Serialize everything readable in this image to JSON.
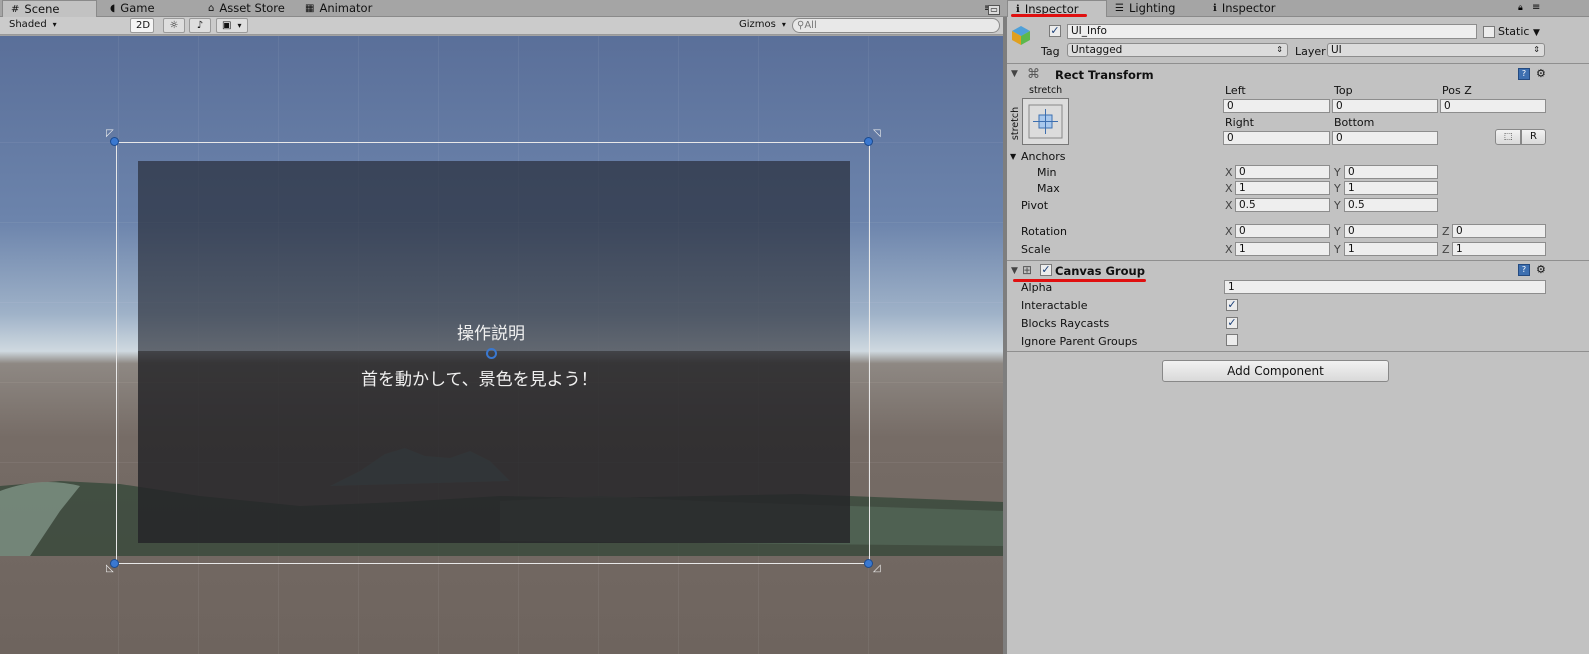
{
  "tabs_left": [
    "Scene",
    "Game",
    "Asset Store",
    "Animator"
  ],
  "tabs_right": [
    "Inspector",
    "Lighting",
    "Inspector"
  ],
  "scene_toolbar": {
    "shading": "Shaded",
    "mode_2d": "2D",
    "gizmos": "Gizmos",
    "search_placeholder": "All"
  },
  "scene": {
    "heading": "操作説明",
    "body": "首を動かして、景色を見よう！"
  },
  "inspector": {
    "object_name": "UI_Info",
    "static_label": "Static",
    "tag_label": "Tag",
    "tag_value": "Untagged",
    "layer_label": "Layer",
    "layer_value": "UI",
    "rect_transform": {
      "title": "Rect Transform",
      "stretch_top": "stretch",
      "stretch_side": "stretch",
      "col_labels": [
        "Left",
        "Top",
        "Pos Z"
      ],
      "row1": [
        "0",
        "0",
        "0"
      ],
      "col_labels2": [
        "Right",
        "Bottom"
      ],
      "row2": [
        "0",
        "0"
      ],
      "r_button": "R",
      "anchors_label": "Anchors",
      "min_label": "Min",
      "min_x": "0",
      "min_y": "0",
      "max_label": "Max",
      "max_x": "1",
      "max_y": "1",
      "pivot_label": "Pivot",
      "pivot_x": "0.5",
      "pivot_y": "0.5",
      "rotation_label": "Rotation",
      "rotation": [
        "0",
        "0",
        "0"
      ],
      "scale_label": "Scale",
      "scale": [
        "1",
        "1",
        "1"
      ],
      "axis_x": "X",
      "axis_y": "Y",
      "axis_z": "Z"
    },
    "canvas_group": {
      "title": "Canvas Group",
      "alpha_label": "Alpha",
      "alpha_value": "1",
      "interactable_label": "Interactable",
      "interactable": true,
      "blocks_raycasts_label": "Blocks Raycasts",
      "blocks_raycasts": true,
      "ignore_parent_label": "Ignore Parent Groups",
      "ignore_parent": false
    },
    "add_component": "Add Component"
  },
  "colors": {
    "highlight_underline": "#e01010",
    "selection_handle": "#3a78d0"
  }
}
